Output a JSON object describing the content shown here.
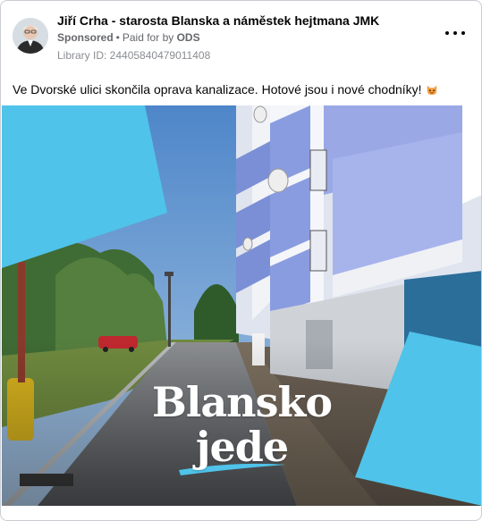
{
  "post": {
    "author": "Jiří Crha - starosta Blanska a náměstek hejtmana JMK",
    "sponsored_label": "Sponsored",
    "separator": "•",
    "paid_prefix": "Paid for by",
    "paid_by": "ODS",
    "library_id": "Library ID: 24405840479011408",
    "text": "Ve Dvorské ulici skončila oprava kanalizace. Hotové jsou i nové chodníky!",
    "emoji_icon": "cat-face-emoji-icon",
    "more_icon": "more-options-icon"
  },
  "ad": {
    "logo_line1": "Blansko",
    "logo_line2": "jede",
    "accent_color": "#4fc3ea",
    "text_color": "#ffffff"
  }
}
